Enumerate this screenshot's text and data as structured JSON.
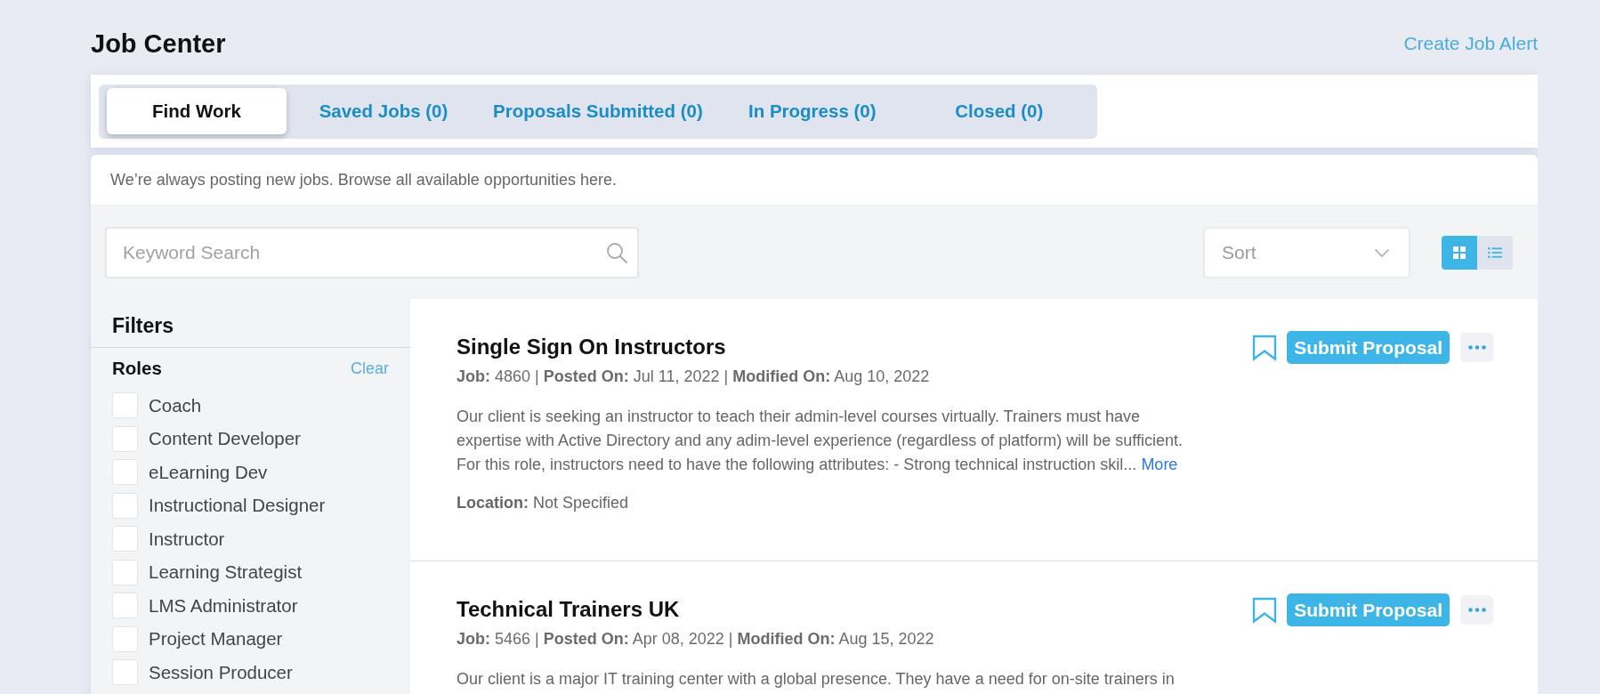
{
  "header": {
    "title": "Job Center",
    "link": "Create Job Alert"
  },
  "tabs": [
    {
      "label": "Find Work",
      "selected": true
    },
    {
      "label": "Saved Jobs (0)",
      "selected": false
    },
    {
      "label": "Proposals Submitted (0)",
      "selected": false
    },
    {
      "label": "In Progress (0)",
      "selected": false
    },
    {
      "label": "Closed (0)",
      "selected": false
    }
  ],
  "intro": "We’re always posting new jobs. Browse all available opportunities here.",
  "search": {
    "placeholder": "Keyword Search"
  },
  "sort": {
    "placeholder": "Sort"
  },
  "view_toggle": [
    {
      "kind": "grid",
      "selected": true
    },
    {
      "kind": "list",
      "selected": false
    }
  ],
  "filters": {
    "title": "Filters",
    "sections": [
      {
        "title": "Roles",
        "clear": "Clear",
        "options": [
          {
            "label": "Coach",
            "checked": false
          },
          {
            "label": "Content Developer",
            "checked": false
          },
          {
            "label": "eLearning Dev",
            "checked": false
          },
          {
            "label": "Instructional Designer",
            "checked": false
          },
          {
            "label": "Instructor",
            "checked": false
          },
          {
            "label": "Learning Strategist",
            "checked": false
          },
          {
            "label": "LMS Administrator",
            "checked": false
          },
          {
            "label": "Project Manager",
            "checked": false
          },
          {
            "label": "Session Producer",
            "checked": false
          }
        ]
      }
    ]
  },
  "jobs": [
    {
      "title": "Single Sign On Instructors",
      "meta": "**Job:** 4860 | **Posted On:** Jul 11, 2022 | **Modified On:** Aug 10, 2022",
      "description": "Our client is seeking an instructor to teach their admin-level courses virtually. Trainers must have expertise with Active Directory and any adim-level experience (regardless of platform) will be sufficient. For this role, instructors need to have the following attributes: - Strong technical instruction skil...",
      "more": "More",
      "location": "**Location:** Not Specified",
      "saved": false,
      "action": "Submit Proposal"
    },
    {
      "title": "Technical Trainers UK",
      "meta": "**Job:** 5466 | **Posted On:** Apr 08, 2022 | **Modified On:** Aug 15, 2022",
      "description": "Our client is a major IT training center with a global presence. They have a need for on-site trainers in",
      "saved": false,
      "action": "Submit Proposal"
    }
  ]
}
